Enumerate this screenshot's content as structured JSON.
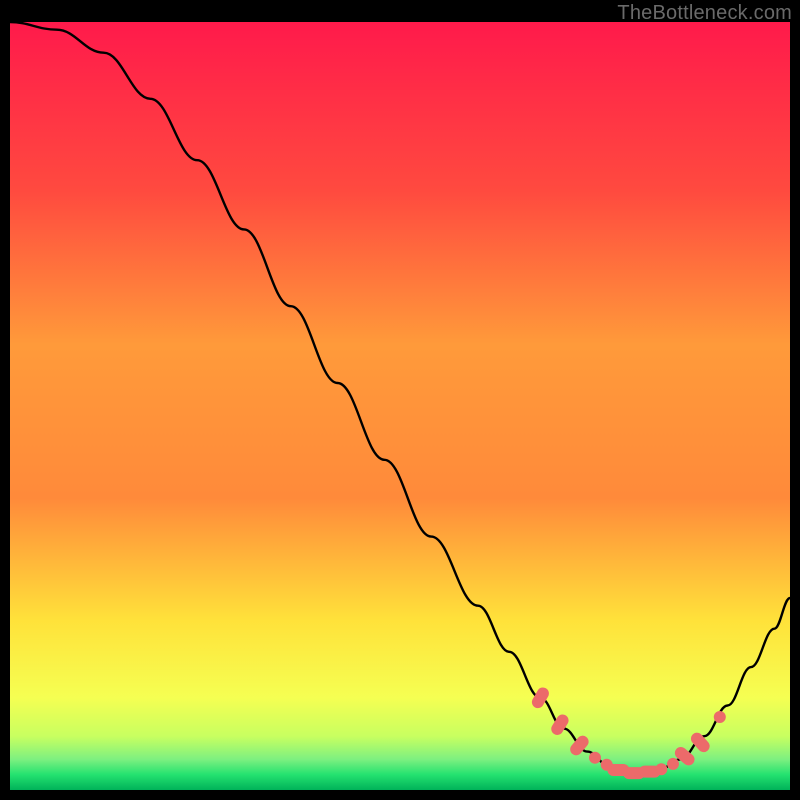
{
  "watermark": "TheBottleneck.com",
  "chart_data": {
    "type": "line",
    "title": "",
    "xlabel": "",
    "ylabel": "",
    "xlim": [
      0,
      100
    ],
    "ylim": [
      0,
      100
    ],
    "grid": false,
    "legend": false,
    "background_gradient": {
      "top": "#ff1a4b",
      "upper_mid": "#ff8a3a",
      "mid": "#ffe23a",
      "lower_mid": "#f5ff52",
      "green_band": "#24e270",
      "bottom": "#00b259"
    },
    "curve": [
      {
        "x": 0,
        "y": 100
      },
      {
        "x": 6,
        "y": 99
      },
      {
        "x": 12,
        "y": 96
      },
      {
        "x": 18,
        "y": 90
      },
      {
        "x": 24,
        "y": 82
      },
      {
        "x": 30,
        "y": 73
      },
      {
        "x": 36,
        "y": 63
      },
      {
        "x": 42,
        "y": 53
      },
      {
        "x": 48,
        "y": 43
      },
      {
        "x": 54,
        "y": 33
      },
      {
        "x": 60,
        "y": 24
      },
      {
        "x": 64,
        "y": 18
      },
      {
        "x": 68,
        "y": 12
      },
      {
        "x": 71,
        "y": 8
      },
      {
        "x": 74,
        "y": 5
      },
      {
        "x": 77,
        "y": 3
      },
      {
        "x": 80,
        "y": 2.2
      },
      {
        "x": 83,
        "y": 2.5
      },
      {
        "x": 86,
        "y": 4
      },
      {
        "x": 89,
        "y": 7
      },
      {
        "x": 92,
        "y": 11
      },
      {
        "x": 95,
        "y": 16
      },
      {
        "x": 98,
        "y": 21
      },
      {
        "x": 100,
        "y": 25
      }
    ],
    "markers": [
      {
        "x": 68,
        "y": 12,
        "shape": "pill",
        "angle": -60
      },
      {
        "x": 70.5,
        "y": 8.5,
        "shape": "pill",
        "angle": -58
      },
      {
        "x": 73,
        "y": 5.8,
        "shape": "pill",
        "angle": -50
      },
      {
        "x": 75,
        "y": 4.2,
        "shape": "dot"
      },
      {
        "x": 76.5,
        "y": 3.3,
        "shape": "dot"
      },
      {
        "x": 78,
        "y": 2.6,
        "shape": "pill",
        "angle": 0
      },
      {
        "x": 80,
        "y": 2.2,
        "shape": "pill",
        "angle": 0
      },
      {
        "x": 82,
        "y": 2.4,
        "shape": "pill",
        "angle": 0
      },
      {
        "x": 83.5,
        "y": 2.7,
        "shape": "dot"
      },
      {
        "x": 85,
        "y": 3.4,
        "shape": "dot"
      },
      {
        "x": 86.5,
        "y": 4.4,
        "shape": "pill",
        "angle": 40
      },
      {
        "x": 88.5,
        "y": 6.2,
        "shape": "pill",
        "angle": 48
      },
      {
        "x": 91,
        "y": 9.5,
        "shape": "dot"
      }
    ],
    "marker_color": "#ec6a6a",
    "line_color": "#000000"
  }
}
